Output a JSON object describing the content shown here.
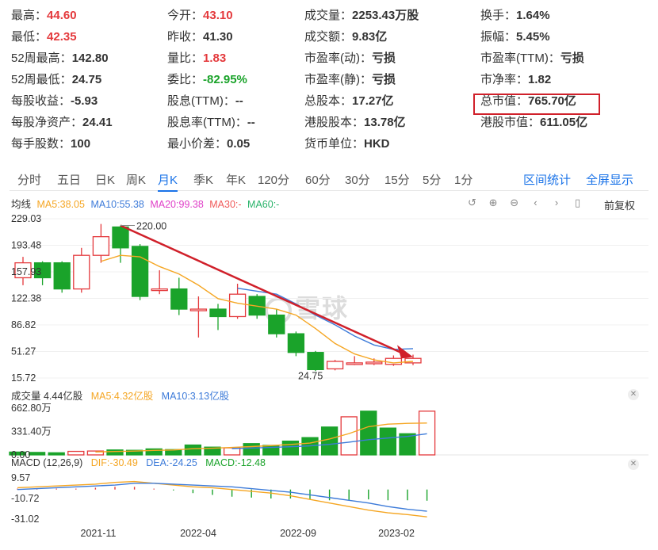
{
  "quote": {
    "rows": [
      [
        {
          "label": "最高：",
          "value": "44.60",
          "color": "up"
        },
        {
          "label": "今开：",
          "value": "43.10",
          "color": "up"
        },
        {
          "label": "成交量：",
          "value": "2253.43万股",
          "color": ""
        },
        {
          "label": "换手：",
          "value": "1.64%",
          "color": ""
        }
      ],
      [
        {
          "label": "最低：",
          "value": "42.35",
          "color": "up"
        },
        {
          "label": "昨收：",
          "value": "41.30",
          "color": ""
        },
        {
          "label": "成交额：",
          "value": "9.83亿",
          "color": ""
        },
        {
          "label": "振幅：",
          "value": "5.45%",
          "color": ""
        }
      ],
      [
        {
          "label": "52周最高：",
          "value": "142.80",
          "color": ""
        },
        {
          "label": "量比：",
          "value": "1.83",
          "color": "up"
        },
        {
          "label": "市盈率(动)：",
          "value": "亏损",
          "color": ""
        },
        {
          "label": "市盈率(TTM)：",
          "value": "亏损",
          "color": ""
        }
      ],
      [
        {
          "label": "52周最低：",
          "value": "24.75",
          "color": ""
        },
        {
          "label": "委比：",
          "value": "-82.95%",
          "color": "down"
        },
        {
          "label": "市盈率(静)：",
          "value": "亏损",
          "color": ""
        },
        {
          "label": "市净率：",
          "value": "1.82",
          "color": ""
        }
      ],
      [
        {
          "label": "每股收益：",
          "value": "-5.93",
          "color": ""
        },
        {
          "label": "股息(TTM)：",
          "value": "--",
          "color": ""
        },
        {
          "label": "总股本：",
          "value": "17.27亿",
          "color": ""
        },
        {
          "label": "总市值：",
          "value": "765.70亿",
          "color": ""
        }
      ],
      [
        {
          "label": "每股净资产：",
          "value": "24.41",
          "color": ""
        },
        {
          "label": "股息率(TTM)：",
          "value": "--",
          "color": ""
        },
        {
          "label": "港股股本：",
          "value": "13.78亿",
          "color": ""
        },
        {
          "label": "港股市值：",
          "value": "611.05亿",
          "color": ""
        }
      ],
      [
        {
          "label": "每手股数：",
          "value": "100",
          "color": ""
        },
        {
          "label": "最小价差：",
          "value": "0.05",
          "color": ""
        },
        {
          "label": "货币单位：",
          "value": "HKD",
          "color": ""
        }
      ]
    ]
  },
  "tabs": [
    "分时",
    "五日",
    "日K",
    "周K",
    "月K",
    "季K",
    "年K",
    "120分",
    "60分",
    "30分",
    "15分",
    "5分",
    "1分"
  ],
  "active_tab": "月K",
  "tab_actions": {
    "range_stats": "区间统计",
    "fullscreen": "全屏显示"
  },
  "ma_legend": {
    "label": "均线",
    "ma5": "MA5:38.05",
    "ma10": "MA10:55.38",
    "ma20": "MA20:99.38",
    "ma30": "MA30:-",
    "ma60": "MA60:-"
  },
  "adjust_label": "前复权",
  "watermark": "雪球",
  "colors": {
    "up": "#e4393c",
    "down": "#1aa32a",
    "ma5": "#f5a623",
    "ma10": "#3d7bd9",
    "ma20": "#e040c8",
    "ma30": "#f05a5a",
    "ma60": "#29b36a",
    "accent": "#1a73e8"
  },
  "volume_legend": {
    "label": "成交量 4.44亿股",
    "ma5": "MA5:4.32亿股",
    "ma10": "MA10:3.13亿股"
  },
  "macd_legend": {
    "label": "MACD (12,26,9)",
    "dif": "DIF:-30.49",
    "dea": "DEA:-24.25",
    "macd": "MACD:-12.48"
  },
  "chart_data": {
    "type": "candlestick",
    "price_axis": {
      "ticks": [
        "229.03",
        "193.48",
        "157.93",
        "122.38",
        "86.82",
        "51.27",
        "15.72"
      ],
      "range": [
        15.72,
        229.03
      ]
    },
    "annotations": {
      "high_label": "220.00",
      "low_label": "24.75"
    },
    "candles": [
      {
        "open": 150,
        "close": 170,
        "high": 178,
        "low": 140
      },
      {
        "open": 170,
        "close": 150,
        "high": 172,
        "low": 140
      },
      {
        "open": 170,
        "close": 135,
        "high": 172,
        "low": 130
      },
      {
        "open": 135,
        "close": 180,
        "high": 190,
        "low": 130
      },
      {
        "open": 180,
        "close": 205,
        "high": 222,
        "low": 170
      },
      {
        "open": 218,
        "close": 190,
        "high": 220,
        "low": 170
      },
      {
        "open": 192,
        "close": 125,
        "high": 195,
        "low": 120
      },
      {
        "open": 135,
        "close": 135,
        "high": 160,
        "low": 128
      },
      {
        "open": 135,
        "close": 108,
        "high": 150,
        "low": 100
      },
      {
        "open": 108,
        "close": 108,
        "high": 125,
        "low": 70
      },
      {
        "open": 108,
        "close": 98,
        "high": 115,
        "low": 80
      },
      {
        "open": 98,
        "close": 128,
        "high": 142,
        "low": 95
      },
      {
        "open": 125,
        "close": 100,
        "high": 128,
        "low": 95
      },
      {
        "open": 100,
        "close": 75,
        "high": 108,
        "low": 70
      },
      {
        "open": 75,
        "close": 50,
        "high": 78,
        "low": 45
      },
      {
        "open": 50,
        "close": 27,
        "high": 52,
        "low": 25
      },
      {
        "open": 28,
        "close": 38,
        "high": 40,
        "low": 26
      },
      {
        "open": 36,
        "close": 36,
        "high": 45,
        "low": 33
      },
      {
        "open": 36,
        "close": 37,
        "high": 42,
        "low": 33
      },
      {
        "open": 34,
        "close": 42,
        "high": 46,
        "low": 32
      },
      {
        "open": 36,
        "close": 42,
        "high": 47,
        "low": 33
      }
    ],
    "ma5": [
      null,
      null,
      null,
      null,
      172,
      180,
      178,
      165,
      155,
      140,
      122,
      116,
      112,
      108,
      100,
      82,
      62,
      48,
      40,
      36,
      38
    ],
    "ma10": [
      null,
      null,
      null,
      null,
      null,
      null,
      null,
      null,
      null,
      null,
      null,
      136,
      132,
      128,
      115,
      100,
      87,
      72,
      60,
      54,
      55
    ],
    "trend_arrow": {
      "from": [
        5,
        220
      ],
      "to": [
        20,
        44
      ]
    },
    "volume": {
      "axis_ticks": [
        "662.80万",
        "331.40万",
        "0.00"
      ],
      "range": [
        0,
        662.8
      ],
      "values": [
        40,
        35,
        30,
        50,
        55,
        70,
        65,
        85,
        75,
        140,
        110,
        100,
        160,
        135,
        195,
        245,
        395,
        540,
        620,
        380,
        300,
        620
      ],
      "up": [
        false,
        false,
        false,
        true,
        true,
        false,
        false,
        false,
        false,
        false,
        false,
        true,
        false,
        false,
        false,
        false,
        false,
        true,
        false,
        false,
        false,
        true
      ],
      "ma5": [
        null,
        null,
        null,
        null,
        42,
        48,
        54,
        64,
        70,
        88,
        95,
        106,
        118,
        132,
        148,
        168,
        226,
        302,
        400,
        436,
        447,
        452
      ],
      "ma10": [
        null,
        null,
        null,
        null,
        null,
        null,
        null,
        null,
        null,
        null,
        null,
        90,
        98,
        106,
        116,
        128,
        150,
        180,
        215,
        240,
        262,
        300
      ]
    },
    "macd": {
      "axis_ticks": [
        "9.57",
        "-10.72",
        "-31.02"
      ],
      "range": [
        -33,
        13
      ],
      "dif": [
        2,
        3,
        4,
        5,
        6,
        8,
        9,
        7,
        5,
        3,
        2,
        0,
        -2,
        -4,
        -7,
        -11,
        -15,
        -19,
        -23,
        -26,
        -28,
        -30.49
      ],
      "dea": [
        0,
        1,
        2,
        3,
        4,
        5,
        7,
        7,
        6,
        5,
        4,
        3,
        1,
        -1,
        -3,
        -6,
        -9,
        -12,
        -15,
        -19,
        -22,
        -24.25
      ],
      "hist": [
        1,
        1,
        1,
        1,
        2,
        3,
        3,
        1,
        -1,
        -4,
        -6,
        -8,
        -9,
        -10,
        -10,
        -11,
        -12,
        -12,
        -11,
        -12,
        -12,
        -12.48
      ]
    },
    "dates": [
      "2021-11",
      "2022-04",
      "2022-09",
      "2023-02"
    ]
  }
}
